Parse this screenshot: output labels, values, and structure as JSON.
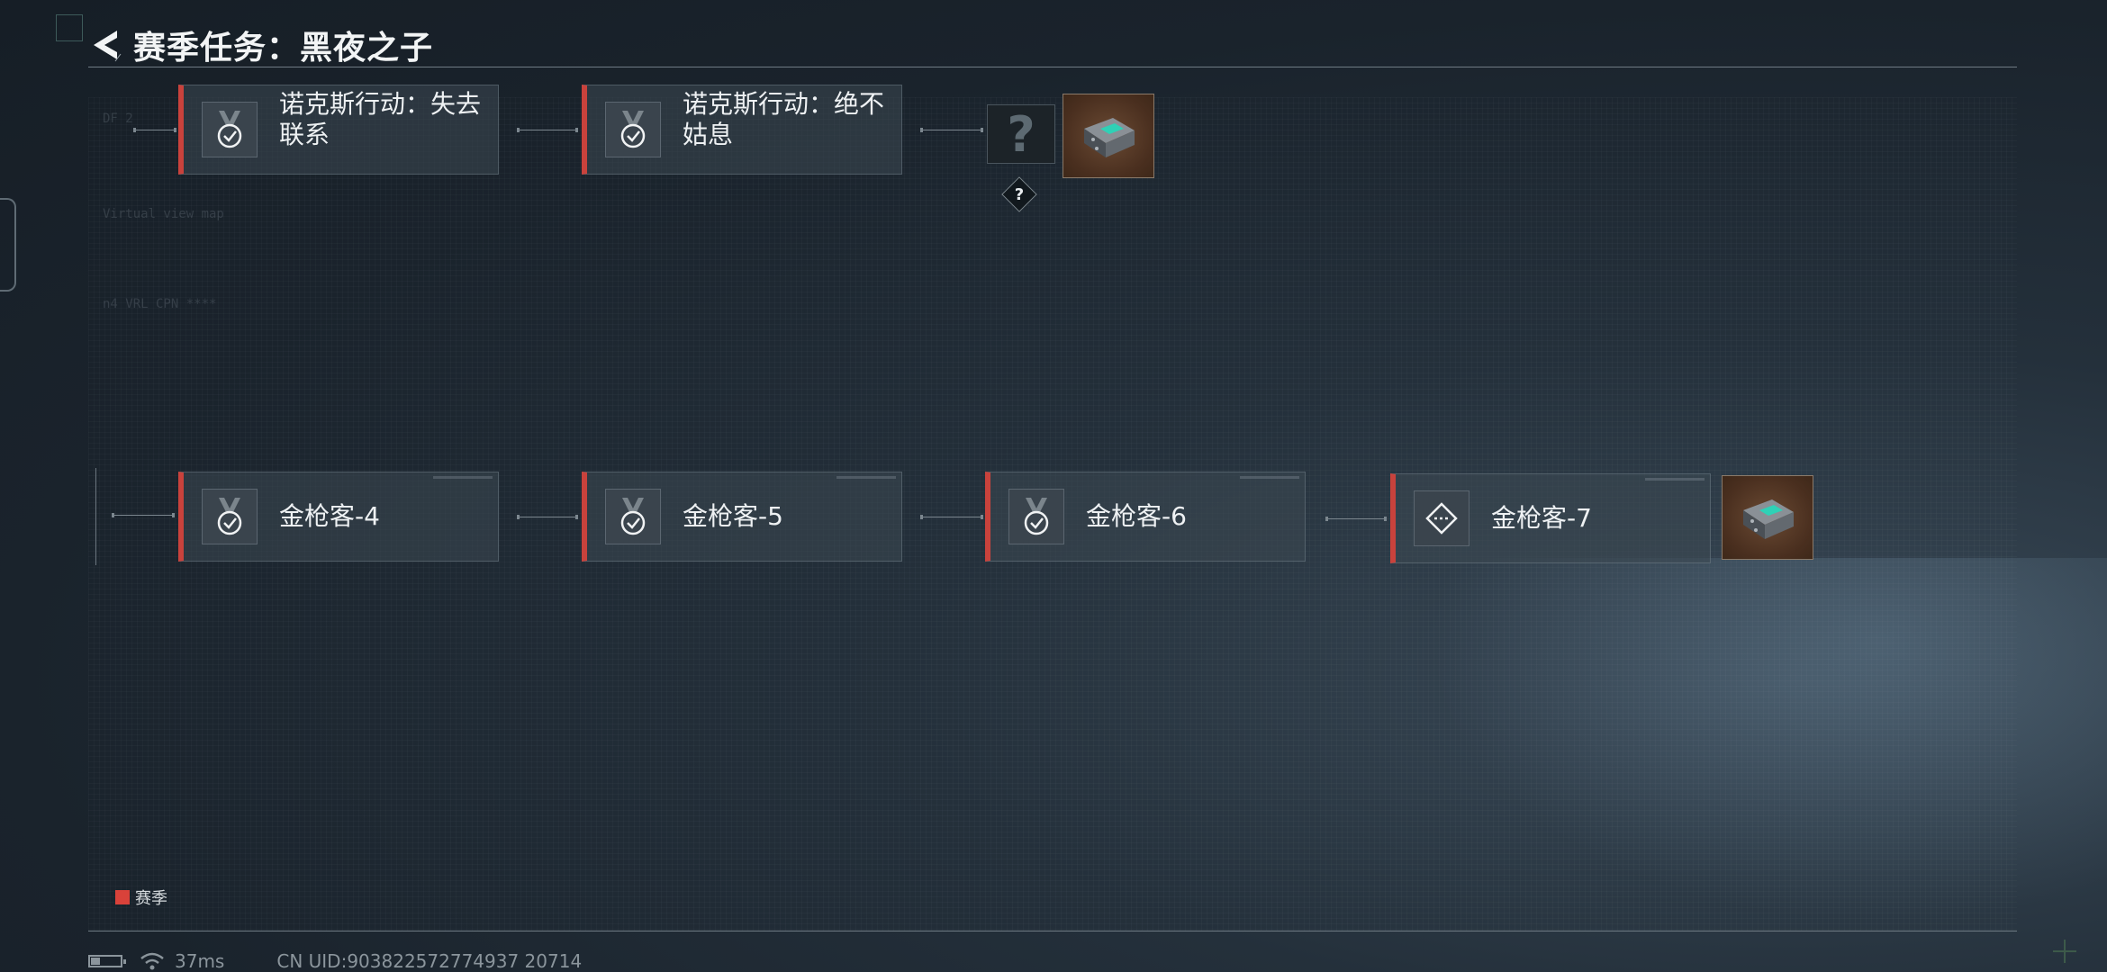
{
  "header": {
    "title": "赛季任务：黑夜之子"
  },
  "tasks_row1": [
    {
      "label": "诺克斯行动：失去\n联系",
      "icon": "medal-check-icon"
    },
    {
      "label": "诺克斯行动：绝不\n姑息",
      "icon": "medal-check-icon"
    }
  ],
  "mystery": {
    "symbol": "?",
    "badge": "?"
  },
  "tasks_row2": [
    {
      "label": "金枪客-4",
      "icon": "medal-check-icon"
    },
    {
      "label": "金枪客-5",
      "icon": "medal-check-icon"
    },
    {
      "label": "金枪客-6",
      "icon": "medal-check-icon"
    },
    {
      "label": "金枪客-7",
      "icon": "diamond-arrow-icon"
    }
  ],
  "rewards": [
    {
      "icon": "supply-crate-icon"
    },
    {
      "icon": "supply-crate-icon"
    }
  ],
  "legend": {
    "label": "赛季",
    "color": "#d9423a"
  },
  "status": {
    "ping": "37ms",
    "uid": "CN UID:903822572774937 20714",
    "battery_level": 0.3
  },
  "colors": {
    "accent": "#c9423c"
  }
}
